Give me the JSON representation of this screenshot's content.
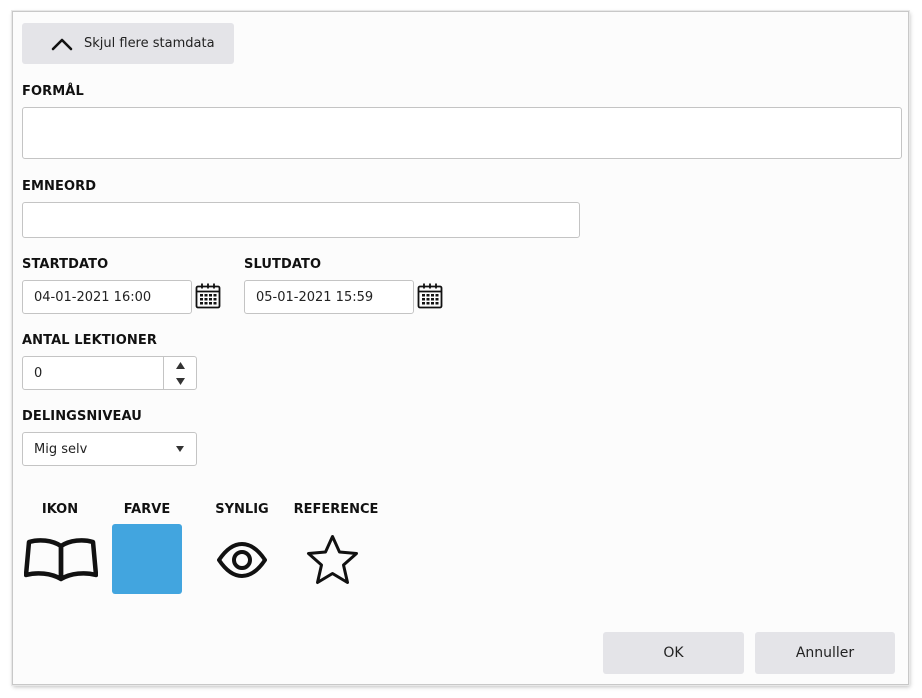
{
  "toggle": {
    "label": "Skjul flere stamdata",
    "icon": "chevron-up-icon"
  },
  "purpose": {
    "label": "FORMÅL",
    "value": ""
  },
  "keywords": {
    "label": "EMNEORD",
    "value": ""
  },
  "start_date": {
    "label": "STARTDATO",
    "value": "04-01-2021 16:00",
    "icon": "calendar-icon"
  },
  "end_date": {
    "label": "SLUTDATO",
    "value": "05-01-2021 15:59",
    "icon": "calendar-icon"
  },
  "lessons": {
    "label": "ANTAL LEKTIONER",
    "value": "0"
  },
  "sharing": {
    "label": "DELINGSNIVEAU",
    "selected": "Mig selv"
  },
  "appearance": {
    "icon_label": "IKON",
    "icon": "open-book-icon",
    "color_label": "FARVE",
    "color": "#42a5df",
    "visible_label": "SYNLIG",
    "visible_icon": "eye-icon",
    "reference_label": "REFERENCE",
    "reference_icon": "star-outline-icon"
  },
  "actions": {
    "ok_label": "OK",
    "cancel_label": "Annuller"
  }
}
